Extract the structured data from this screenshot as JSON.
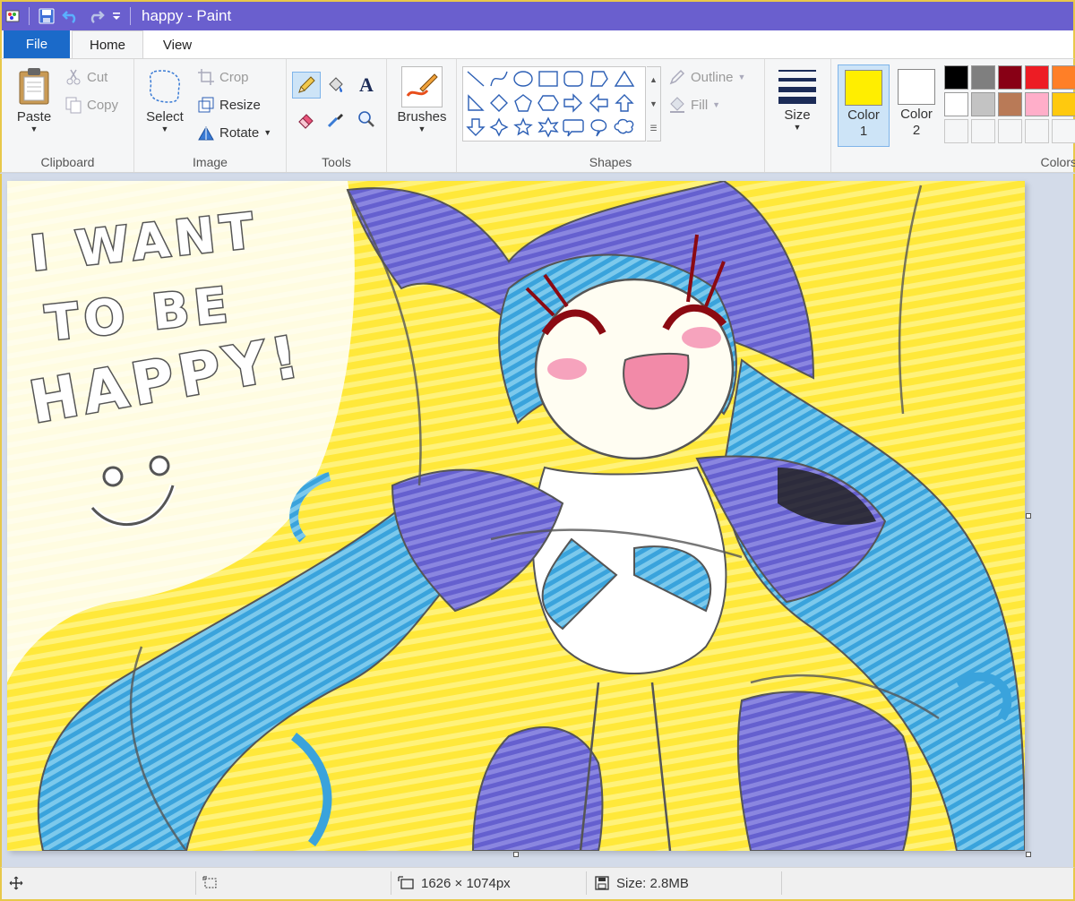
{
  "window": {
    "title": "happy - Paint",
    "quick_access": [
      "save-icon",
      "undo-icon",
      "redo-icon",
      "customize-icon"
    ]
  },
  "tabs": {
    "file": "File",
    "home": "Home",
    "view": "View"
  },
  "ribbon": {
    "clipboard": {
      "label": "Clipboard",
      "paste": "Paste",
      "cut": "Cut",
      "copy": "Copy"
    },
    "image": {
      "label": "Image",
      "select": "Select",
      "crop": "Crop",
      "resize": "Resize",
      "rotate": "Rotate"
    },
    "tools": {
      "label": "Tools",
      "items": [
        "pencil-icon",
        "fill-bucket-icon",
        "text-icon",
        "eraser-icon",
        "color-picker-icon",
        "magnifier-icon"
      ],
      "selected": "pencil-icon"
    },
    "brushes": {
      "label": "Brushes"
    },
    "shapes": {
      "label": "Shapes",
      "outline": "Outline",
      "fill": "Fill"
    },
    "size": {
      "label": "Size"
    },
    "colors": {
      "label": "Colors",
      "color1_label": "Color",
      "color1_num": "1",
      "color1_value": "#ffee00",
      "color2_label": "Color",
      "color2_num": "2",
      "color2_value": "#ffffff",
      "palette": [
        "#000000",
        "#7f7f7f",
        "#880015",
        "#ed1c24",
        "#ff7f27",
        "#ffffff",
        "#c3c3c3",
        "#b97a57",
        "#ffaec9",
        "#ffc90e"
      ]
    }
  },
  "canvas": {
    "text_line1": "I WANT",
    "text_line2": "TO BE",
    "text_line3": "HAPPY!"
  },
  "status": {
    "dimensions": "1626 × 1074px",
    "size": "Size: 2.8MB"
  }
}
